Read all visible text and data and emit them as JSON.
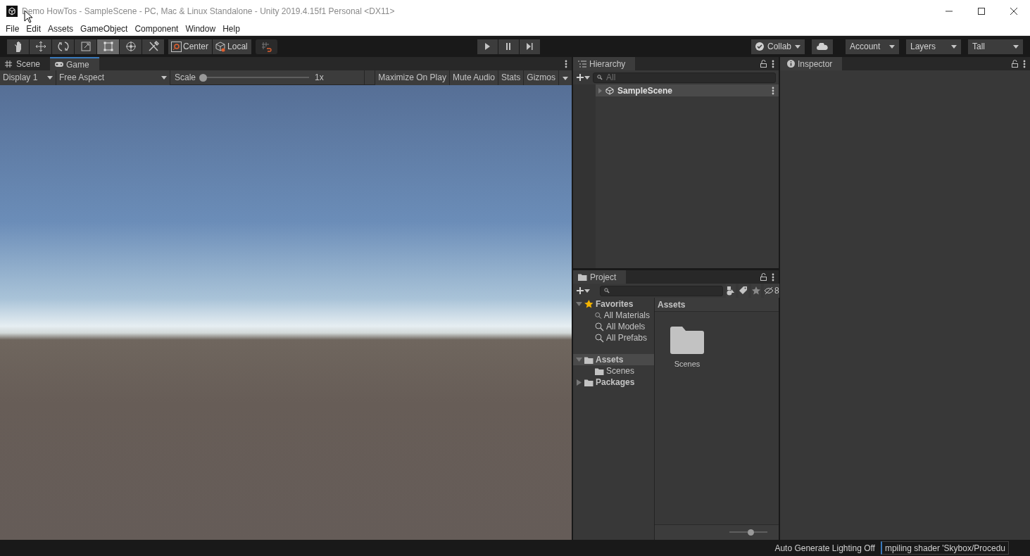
{
  "window": {
    "title": "Demo HowTos - SampleScene - PC, Mac & Linux Standalone - Unity 2019.4.15f1 Personal <DX11>"
  },
  "menu": [
    "File",
    "Edit",
    "Assets",
    "GameObject",
    "Component",
    "Window",
    "Help"
  ],
  "toolbar": {
    "tools": [
      {
        "kind": "hand",
        "selected": false
      },
      {
        "kind": "move",
        "selected": false
      },
      {
        "kind": "rotate",
        "selected": false
      },
      {
        "kind": "scale",
        "selected": false
      },
      {
        "kind": "rect",
        "selected": true
      },
      {
        "kind": "transform",
        "selected": false
      },
      {
        "kind": "custom",
        "selected": false
      }
    ],
    "pivots": [
      {
        "kind": "center",
        "label": "Center"
      },
      {
        "kind": "local",
        "label": "Local"
      }
    ],
    "playback": [
      {
        "kind": "play"
      },
      {
        "kind": "pause"
      },
      {
        "kind": "step"
      }
    ],
    "collab": "Collab",
    "account": "Account",
    "layers": "Layers",
    "layout": "Tall"
  },
  "game_panel": {
    "tabs": [
      {
        "kind": "scene",
        "label": "Scene",
        "selected": false
      },
      {
        "kind": "game",
        "label": "Game",
        "selected": true
      }
    ],
    "display": "Display 1",
    "aspect": "Free Aspect",
    "scale_label": "Scale",
    "scale": {
      "level": 0
    },
    "scale_reading": "1x",
    "toggles": [
      "Maximize On Play",
      "Mute Audio",
      "Stats"
    ],
    "gizmos": "Gizmos"
  },
  "hierarchy": {
    "title": "Hierarchy",
    "placeholder": "All",
    "items": [
      {
        "label": "SampleScene",
        "expanded": false
      }
    ]
  },
  "project": {
    "title": "Project",
    "hidden_count": "8",
    "tree": [
      {
        "kind": "favorites",
        "label": "Favorites",
        "expanded": true,
        "selected": false,
        "children": [
          {
            "kind": "search",
            "label": "All Materials"
          },
          {
            "kind": "search",
            "label": "All Models"
          },
          {
            "kind": "search",
            "label": "All Prefabs"
          }
        ]
      },
      {
        "kind": "folder",
        "label": "Assets",
        "expanded": true,
        "selected": true,
        "children": [
          {
            "kind": "folder",
            "label": "Scenes"
          }
        ]
      },
      {
        "kind": "folder",
        "label": "Packages",
        "expanded": false,
        "selected": false
      }
    ],
    "breadcrumb": "Assets",
    "items": [
      {
        "label": "Scenes"
      }
    ],
    "zoom": {
      "level": 0.55
    }
  },
  "inspector": {
    "title": "Inspector"
  },
  "status_bar": {
    "lighting": "Auto Generate Lighting Off",
    "progress": "mpiling shader 'Skybox/Procedu"
  }
}
